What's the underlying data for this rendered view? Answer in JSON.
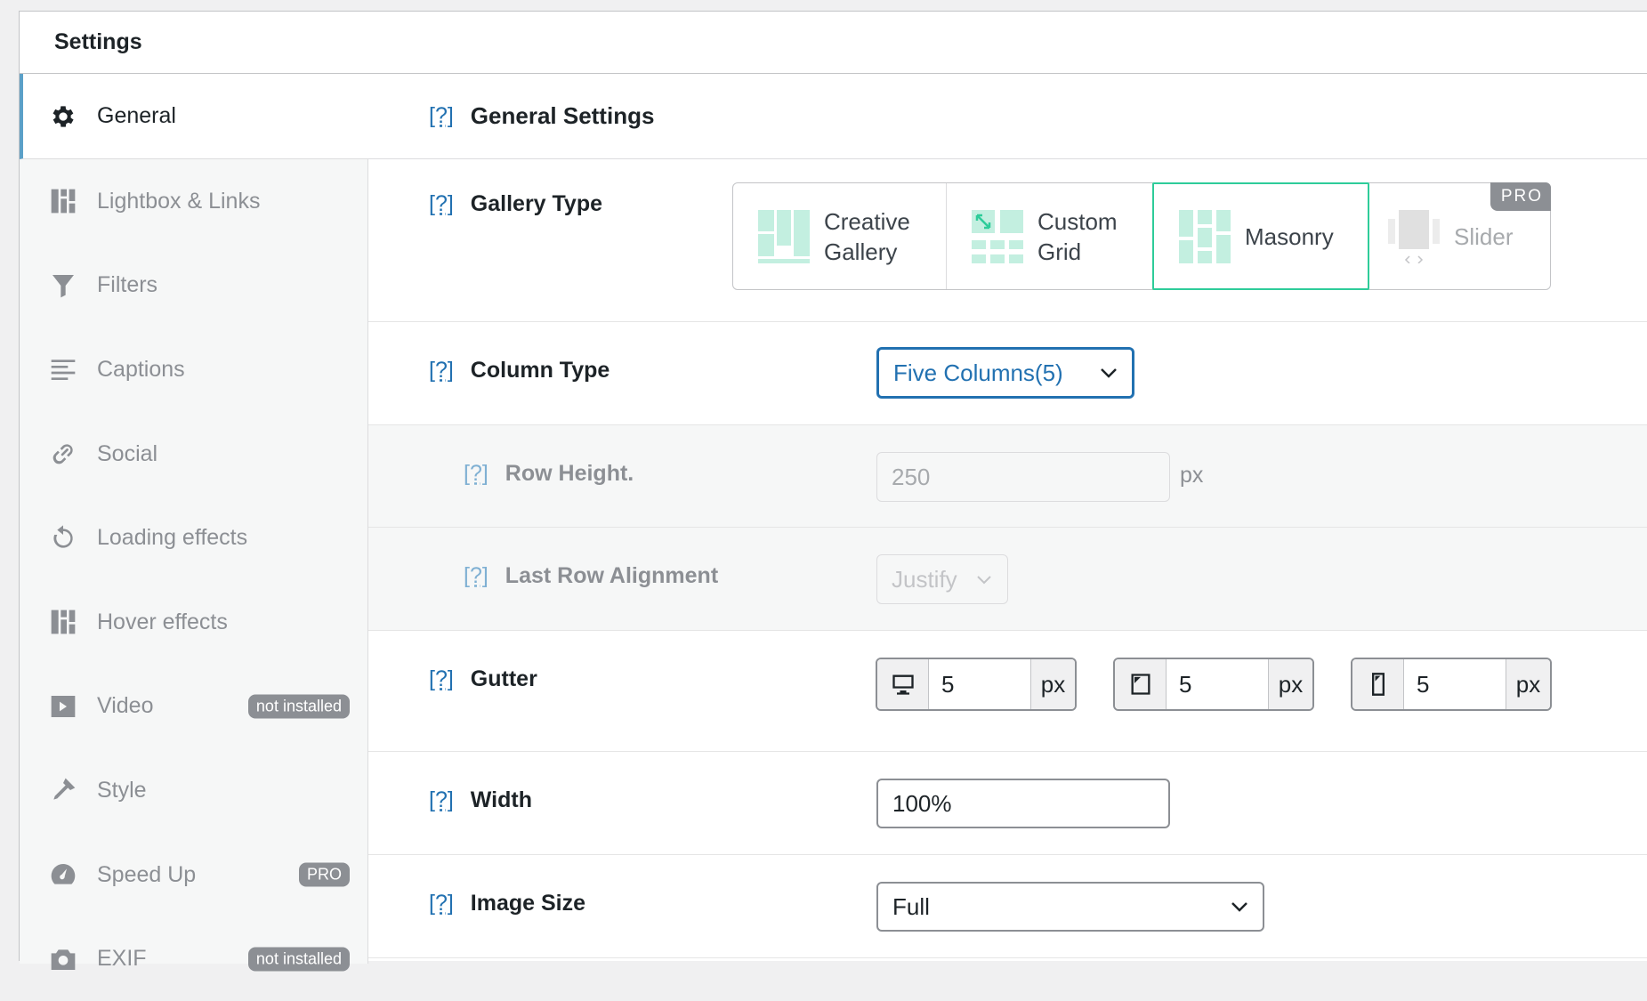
{
  "header": {
    "title": "Settings"
  },
  "sidebar": {
    "items": [
      {
        "label": "General",
        "icon": "gear-icon",
        "active": true
      },
      {
        "label": "Lightbox & Links",
        "icon": "grid-icon"
      },
      {
        "label": "Filters",
        "icon": "filter-icon"
      },
      {
        "label": "Captions",
        "icon": "text-align-icon"
      },
      {
        "label": "Social",
        "icon": "link-icon"
      },
      {
        "label": "Loading effects",
        "icon": "refresh-icon"
      },
      {
        "label": "Hover effects",
        "icon": "grid-icon"
      },
      {
        "label": "Video",
        "icon": "play-icon",
        "badge": "not installed"
      },
      {
        "label": "Style",
        "icon": "brush-icon"
      },
      {
        "label": "Speed Up",
        "icon": "dashboard-icon",
        "badge": "PRO"
      },
      {
        "label": "EXIF",
        "icon": "camera-icon",
        "badge": "not installed"
      }
    ]
  },
  "main": {
    "help": "[?]",
    "title": "General Settings",
    "gallery_type": {
      "label": "Gallery Type",
      "options": [
        {
          "line1": "Creative",
          "line2": "Gallery"
        },
        {
          "line1": "Custom",
          "line2": "Grid"
        },
        {
          "line1": "Masonry",
          "line2": ""
        },
        {
          "line1": "Slider",
          "line2": ""
        }
      ],
      "selected": "Masonry",
      "pro_tag": "PRO"
    },
    "column_type": {
      "label": "Column Type",
      "value": "Five Columns(5)"
    },
    "row_height": {
      "label": "Row Height.",
      "placeholder": "250",
      "unit": "px"
    },
    "last_row": {
      "label": "Last Row Alignment",
      "value": "Justify"
    },
    "gutter": {
      "label": "Gutter",
      "desktop": "5",
      "tablet": "5",
      "mobile": "5",
      "unit": "px"
    },
    "width": {
      "label": "Width",
      "value": "100%"
    },
    "image_size": {
      "label": "Image Size",
      "value": "Full"
    }
  },
  "colors": {
    "accent": "#2271b1",
    "selected_border": "#2ecc9a",
    "active_bar": "#5ba0c8"
  }
}
